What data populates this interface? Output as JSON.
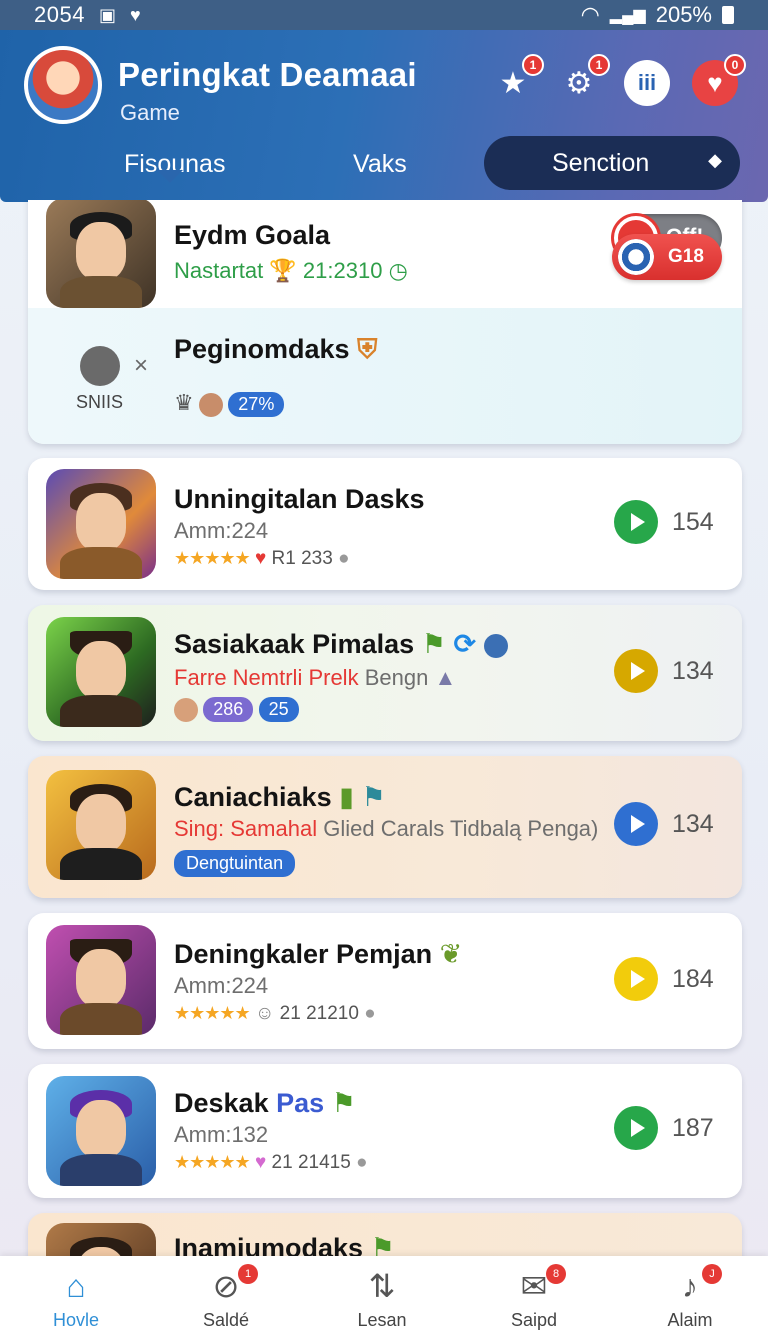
{
  "status_bar": {
    "time": "2054",
    "battery": "205%"
  },
  "header": {
    "title": "Peringkat Deamaai",
    "subtitle": "Game",
    "icons": [
      {
        "name": "star-icon",
        "badge": "1"
      },
      {
        "name": "gear-icon",
        "badge": "1"
      },
      {
        "name": "stats-icon",
        "label": "iii"
      },
      {
        "name": "heart-icon",
        "badge": "0"
      }
    ],
    "tabs": [
      "Fisounas",
      "Vaks",
      "Senction"
    ]
  },
  "cards": [
    {
      "title": "Eydm Goala",
      "sub": "Nastartat",
      "time": "21:2310",
      "toggle": "Off!"
    },
    {
      "title": "Peginomdaks",
      "left_label": "SNIIS",
      "chip": "27%",
      "pill": "G18"
    },
    {
      "title": "Unningitalan Dasks",
      "sub": "Amm:224",
      "rating_text": "R1 233",
      "count": "154",
      "accent": "#27a74a"
    },
    {
      "title": "Sasiakaak Pimalas",
      "sub_red": "Farre Nemtrli Prelk",
      "sub_gray": "Bengn",
      "chip1": "286",
      "chip2": "25",
      "count": "134",
      "accent": "#d6a800"
    },
    {
      "title": "Caniachiaks",
      "sub_red": "Sing: Samahal",
      "sub_gray": "Glied Carals Tidbalą Penga)",
      "chip": "Dengtuintan",
      "count": "134",
      "accent": "#2f6fd1"
    },
    {
      "title": "Deningkaler Pemjan",
      "sub": "Amm:224",
      "rating_text": "21 21210",
      "count": "184",
      "accent": "#f2cc0c"
    },
    {
      "title": "Deskak",
      "title_blue": "Pas",
      "sub": "Amm:132",
      "rating_text": "21 21415",
      "count": "187",
      "accent": "#27a74a"
    },
    {
      "title": "Inamiumodaks"
    }
  ],
  "bottom_nav": [
    {
      "label": "Hovle",
      "icon": "home-icon"
    },
    {
      "label": "Saldé",
      "icon": "compass-icon",
      "badge": "1"
    },
    {
      "label": "Lesan",
      "icon": "swap-icon"
    },
    {
      "label": "Saipd",
      "icon": "mail-icon",
      "badge": "8"
    },
    {
      "label": "Alaim",
      "icon": "bell-icon",
      "badge": "J"
    }
  ]
}
